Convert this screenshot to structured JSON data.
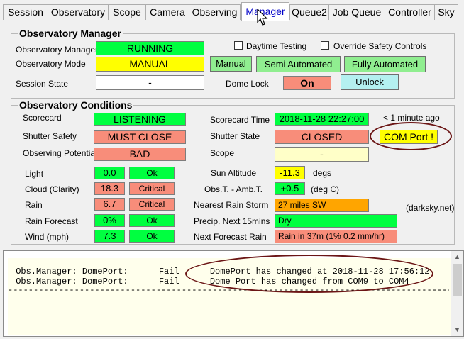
{
  "tabs": [
    "Session",
    "Observatory",
    "Scope",
    "Camera",
    "Observing",
    "Manager",
    "Queue2",
    "Job Queue",
    "Controller",
    "Sky"
  ],
  "manager": {
    "title": "Observatory Manager",
    "om_label": "Observatory Manager",
    "om_value": "RUNNING",
    "mode_label": "Observatory Mode",
    "mode_value": "MANUAL",
    "session_label": "Session State",
    "session_value": "-",
    "daytime_label": "Daytime Testing",
    "override_label": "Override Safety Controls",
    "btn_manual": "Manual",
    "btn_semi": "Semi Automated",
    "btn_fully": "Fully Automated",
    "dome_lock_label": "Dome Lock",
    "dome_lock_value": "On",
    "btn_unlock": "Unlock"
  },
  "conditions": {
    "title": "Observatory Conditions",
    "scorecard_label": "Scorecard",
    "scorecard_value": "LISTENING",
    "shutter_safety_label": "Shutter Safety",
    "shutter_safety_value": "MUST CLOSE",
    "obs_potential_label": "Observing Potential",
    "obs_potential_value": "BAD",
    "scorecard_time_label": "Scorecard Time",
    "scorecard_time_value": "2018-11-28 22:27:00",
    "scorecard_age": "< 1 minute ago",
    "shutter_state_label": "Shutter State",
    "shutter_state_value": "CLOSED",
    "com_port_alert": "COM Port !",
    "scope_label": "Scope",
    "scope_value": "-",
    "light_label": "Light",
    "light_value": "0.0",
    "light_status": "Ok",
    "cloud_label": "Cloud (Clarity)",
    "cloud_value": "18.3",
    "cloud_status": "Critical",
    "rain_label": "Rain",
    "rain_value": "6.7",
    "rain_status": "Critical",
    "rain_forecast_label": "Rain Forecast",
    "rain_forecast_value": "0%",
    "rain_forecast_status": "Ok",
    "wind_label": "Wind (mph)",
    "wind_value": "7.3",
    "wind_status": "Ok",
    "sun_alt_label": "Sun Altitude",
    "sun_alt_value": "-11.3",
    "sun_alt_unit": "degs",
    "obs_amb_label": "Obs.T. - Amb.T.",
    "obs_amb_value": "+0.5",
    "obs_amb_unit": "(deg C)",
    "nearest_rain_label": "Nearest Rain Storm",
    "nearest_rain_value": "27 miles SW",
    "darksky_label": "(darksky.net)",
    "precip_label": "Precip. Next 15mins",
    "precip_value": "Dry",
    "next_rain_label": "Next Forecast Rain",
    "next_rain_value": "Rain in 37m (1%  0.2 mm/hr)"
  },
  "log": {
    "lines": [
      " Obs.Manager: DomePort:      Fail      DomePort has changed at 2018-11-28 17:56:12",
      " Obs.Manager: DomePort:      Fail      Dome Port has changed from COM9 to COM4"
    ],
    "separator": "-----------------------------------------------------------------------------------------"
  },
  "colors": {
    "green": "#00ff40",
    "salmon": "#f88d7a",
    "yellow": "#ffff00",
    "annotation": "#6b1515"
  }
}
